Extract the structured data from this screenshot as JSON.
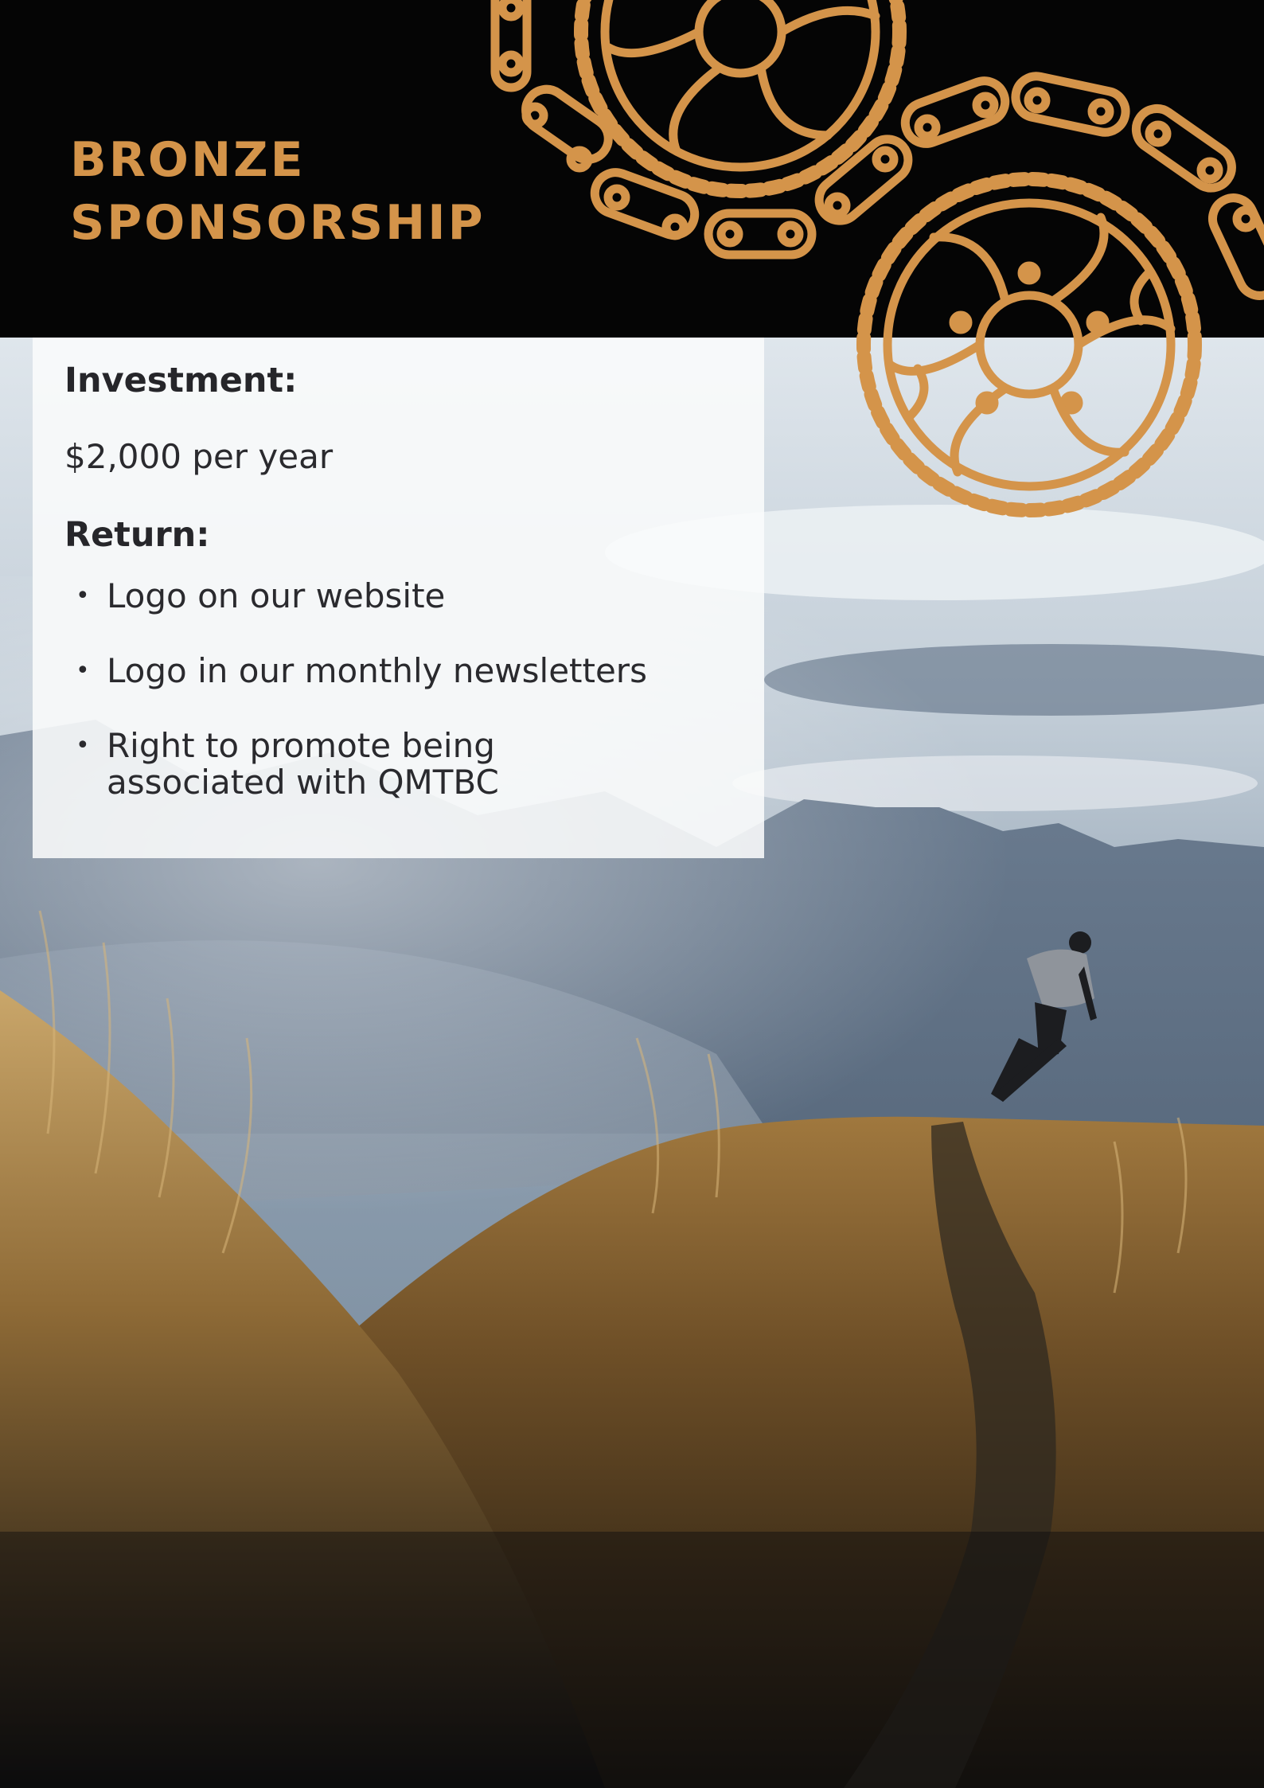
{
  "header": {
    "title_line1": "BRONZE",
    "title_line2": "SPONSORSHIP"
  },
  "panel": {
    "investment_label": "Investment:",
    "investment_value": "$2,000 per year",
    "return_label": "Return:",
    "returns": [
      "Logo on our website",
      "Logo in our monthly newsletters",
      "Right to promote being associated with QMTBC"
    ]
  },
  "colors": {
    "header_bg": "#050505",
    "accent": "#d4944a",
    "text": "#2a2a2e"
  },
  "icons": {
    "rotor": "disc-brake-rotor-icon",
    "chain": "bike-chain-icon",
    "bullet": "bullet-icon"
  }
}
